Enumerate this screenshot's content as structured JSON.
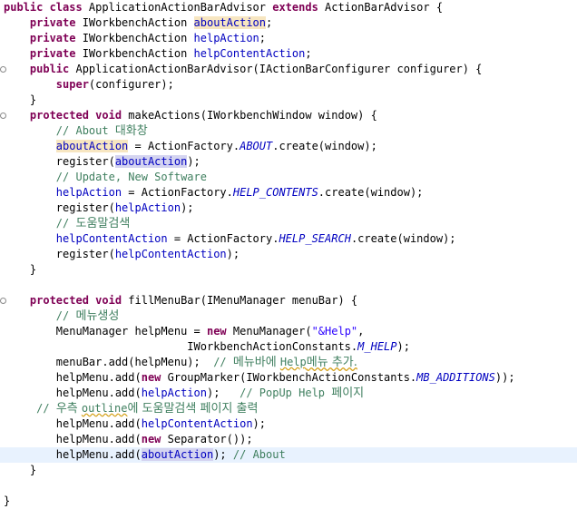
{
  "editor": {
    "lines": [
      {
        "tokens": [
          {
            "t": "public class ",
            "c": "kw"
          },
          {
            "t": "ApplicationActionBarAdvisor "
          },
          {
            "t": "extends ",
            "c": "kw"
          },
          {
            "t": "ActionBarAdvisor {"
          }
        ]
      },
      {
        "tokens": [
          {
            "t": "    "
          },
          {
            "t": "private ",
            "c": "kw"
          },
          {
            "t": "IWorkbenchAction "
          },
          {
            "t": "aboutAction",
            "c": "fld occ"
          },
          {
            "t": ";"
          }
        ]
      },
      {
        "tokens": [
          {
            "t": "    "
          },
          {
            "t": "private ",
            "c": "kw"
          },
          {
            "t": "IWorkbenchAction "
          },
          {
            "t": "helpAction",
            "c": "fld"
          },
          {
            "t": ";"
          }
        ]
      },
      {
        "tokens": [
          {
            "t": "    "
          },
          {
            "t": "private ",
            "c": "kw"
          },
          {
            "t": "IWorkbenchAction "
          },
          {
            "t": "helpContentAction",
            "c": "fld"
          },
          {
            "t": ";"
          }
        ]
      },
      {
        "fold": true,
        "tokens": [
          {
            "t": "    "
          },
          {
            "t": "public ",
            "c": "kw"
          },
          {
            "t": "ApplicationActionBarAdvisor(IActionBarConfigurer configurer) {"
          }
        ]
      },
      {
        "tokens": [
          {
            "t": "        "
          },
          {
            "t": "super",
            "c": "kw"
          },
          {
            "t": "(configurer);"
          }
        ]
      },
      {
        "tokens": [
          {
            "t": "    }"
          }
        ]
      },
      {
        "fold": true,
        "tokens": [
          {
            "t": "    "
          },
          {
            "t": "protected ",
            "c": "kw"
          },
          {
            "t": "void ",
            "c": "kw"
          },
          {
            "t": "makeActions(IWorkbenchWindow window) {"
          }
        ]
      },
      {
        "tokens": [
          {
            "t": "        "
          },
          {
            "t": "// About ",
            "c": "cm"
          },
          {
            "t": "대화창",
            "c": "cm hangul"
          }
        ]
      },
      {
        "tokens": [
          {
            "t": "        "
          },
          {
            "t": "aboutAction",
            "c": "fld occ"
          },
          {
            "t": " = ActionFactory."
          },
          {
            "t": "ABOUT",
            "c": "sfld"
          },
          {
            "t": ".create(window);"
          }
        ]
      },
      {
        "tokens": [
          {
            "t": "        register("
          },
          {
            "t": "aboutAction",
            "c": "fld occw"
          },
          {
            "t": ");"
          }
        ]
      },
      {
        "tokens": [
          {
            "t": "        "
          },
          {
            "t": "// Update, New Software",
            "c": "cm"
          }
        ]
      },
      {
        "tokens": [
          {
            "t": "        "
          },
          {
            "t": "helpAction",
            "c": "fld"
          },
          {
            "t": " = ActionFactory."
          },
          {
            "t": "HELP_CONTENTS",
            "c": "sfld"
          },
          {
            "t": ".create(window);"
          }
        ]
      },
      {
        "tokens": [
          {
            "t": "        register("
          },
          {
            "t": "helpAction",
            "c": "fld"
          },
          {
            "t": ");"
          }
        ]
      },
      {
        "tokens": [
          {
            "t": "        "
          },
          {
            "t": "// ",
            "c": "cm"
          },
          {
            "t": "도움말검색",
            "c": "cm hangul"
          }
        ]
      },
      {
        "tokens": [
          {
            "t": "        "
          },
          {
            "t": "helpContentAction",
            "c": "fld"
          },
          {
            "t": " = ActionFactory."
          },
          {
            "t": "HELP_SEARCH",
            "c": "sfld"
          },
          {
            "t": ".create(window);"
          }
        ]
      },
      {
        "tokens": [
          {
            "t": "        register("
          },
          {
            "t": "helpContentAction",
            "c": "fld"
          },
          {
            "t": ");"
          }
        ]
      },
      {
        "tokens": [
          {
            "t": "    }"
          }
        ]
      },
      {
        "tokens": [
          {
            "t": ""
          }
        ]
      },
      {
        "fold": true,
        "tokens": [
          {
            "t": "    "
          },
          {
            "t": "protected ",
            "c": "kw"
          },
          {
            "t": "void ",
            "c": "kw"
          },
          {
            "t": "fillMenuBar(IMenuManager menuBar) {"
          }
        ]
      },
      {
        "tokens": [
          {
            "t": "        "
          },
          {
            "t": "// ",
            "c": "cm"
          },
          {
            "t": "메뉴생성",
            "c": "cm hangul"
          }
        ]
      },
      {
        "tokens": [
          {
            "t": "        MenuManager helpMenu = "
          },
          {
            "t": "new ",
            "c": "kw"
          },
          {
            "t": "MenuManager("
          },
          {
            "t": "\"&Help\"",
            "c": "str"
          },
          {
            "t": ","
          }
        ]
      },
      {
        "tokens": [
          {
            "t": "                            IWorkbenchActionConstants."
          },
          {
            "t": "M_HELP",
            "c": "sfld"
          },
          {
            "t": ");"
          }
        ]
      },
      {
        "tokens": [
          {
            "t": "        menuBar.add(helpMenu);  "
          },
          {
            "t": "// ",
            "c": "cm"
          },
          {
            "t": "메뉴바에 ",
            "c": "cm hangul"
          },
          {
            "t": "Help",
            "c": "cm squig"
          },
          {
            "t": "메뉴 추가.",
            "c": "cm hangul squig"
          }
        ]
      },
      {
        "tokens": [
          {
            "t": "        helpMenu.add("
          },
          {
            "t": "new ",
            "c": "kw"
          },
          {
            "t": "GroupMarker(IWorkbenchActionConstants."
          },
          {
            "t": "MB_ADDITIONS",
            "c": "sfld"
          },
          {
            "t": "));"
          }
        ]
      },
      {
        "tokens": [
          {
            "t": "        helpMenu.add("
          },
          {
            "t": "helpAction",
            "c": "fld"
          },
          {
            "t": ");   "
          },
          {
            "t": "// PopUp Help ",
            "c": "cm"
          },
          {
            "t": "페이지",
            "c": "cm hangul"
          }
        ]
      },
      {
        "tokens": [
          {
            "t": "     "
          },
          {
            "t": "// ",
            "c": "cm"
          },
          {
            "t": "우측 ",
            "c": "cm hangul"
          },
          {
            "t": "outline",
            "c": "cm squig"
          },
          {
            "t": "에 도움말검색 페이지 출력",
            "c": "cm hangul"
          }
        ]
      },
      {
        "tokens": [
          {
            "t": "        helpMenu.add("
          },
          {
            "t": "helpContentAction",
            "c": "fld"
          },
          {
            "t": ");"
          }
        ]
      },
      {
        "tokens": [
          {
            "t": "        helpMenu.add("
          },
          {
            "t": "new ",
            "c": "kw"
          },
          {
            "t": "Separator());"
          }
        ]
      },
      {
        "current": true,
        "tokens": [
          {
            "t": "        helpMenu.add("
          },
          {
            "t": "aboutAction",
            "c": "fld occw"
          },
          {
            "t": "); "
          },
          {
            "t": "// About",
            "c": "cm"
          }
        ]
      },
      {
        "tokens": [
          {
            "t": "    }"
          }
        ]
      },
      {
        "tokens": [
          {
            "t": ""
          }
        ]
      },
      {
        "tokens": [
          {
            "t": "}"
          }
        ]
      }
    ]
  }
}
